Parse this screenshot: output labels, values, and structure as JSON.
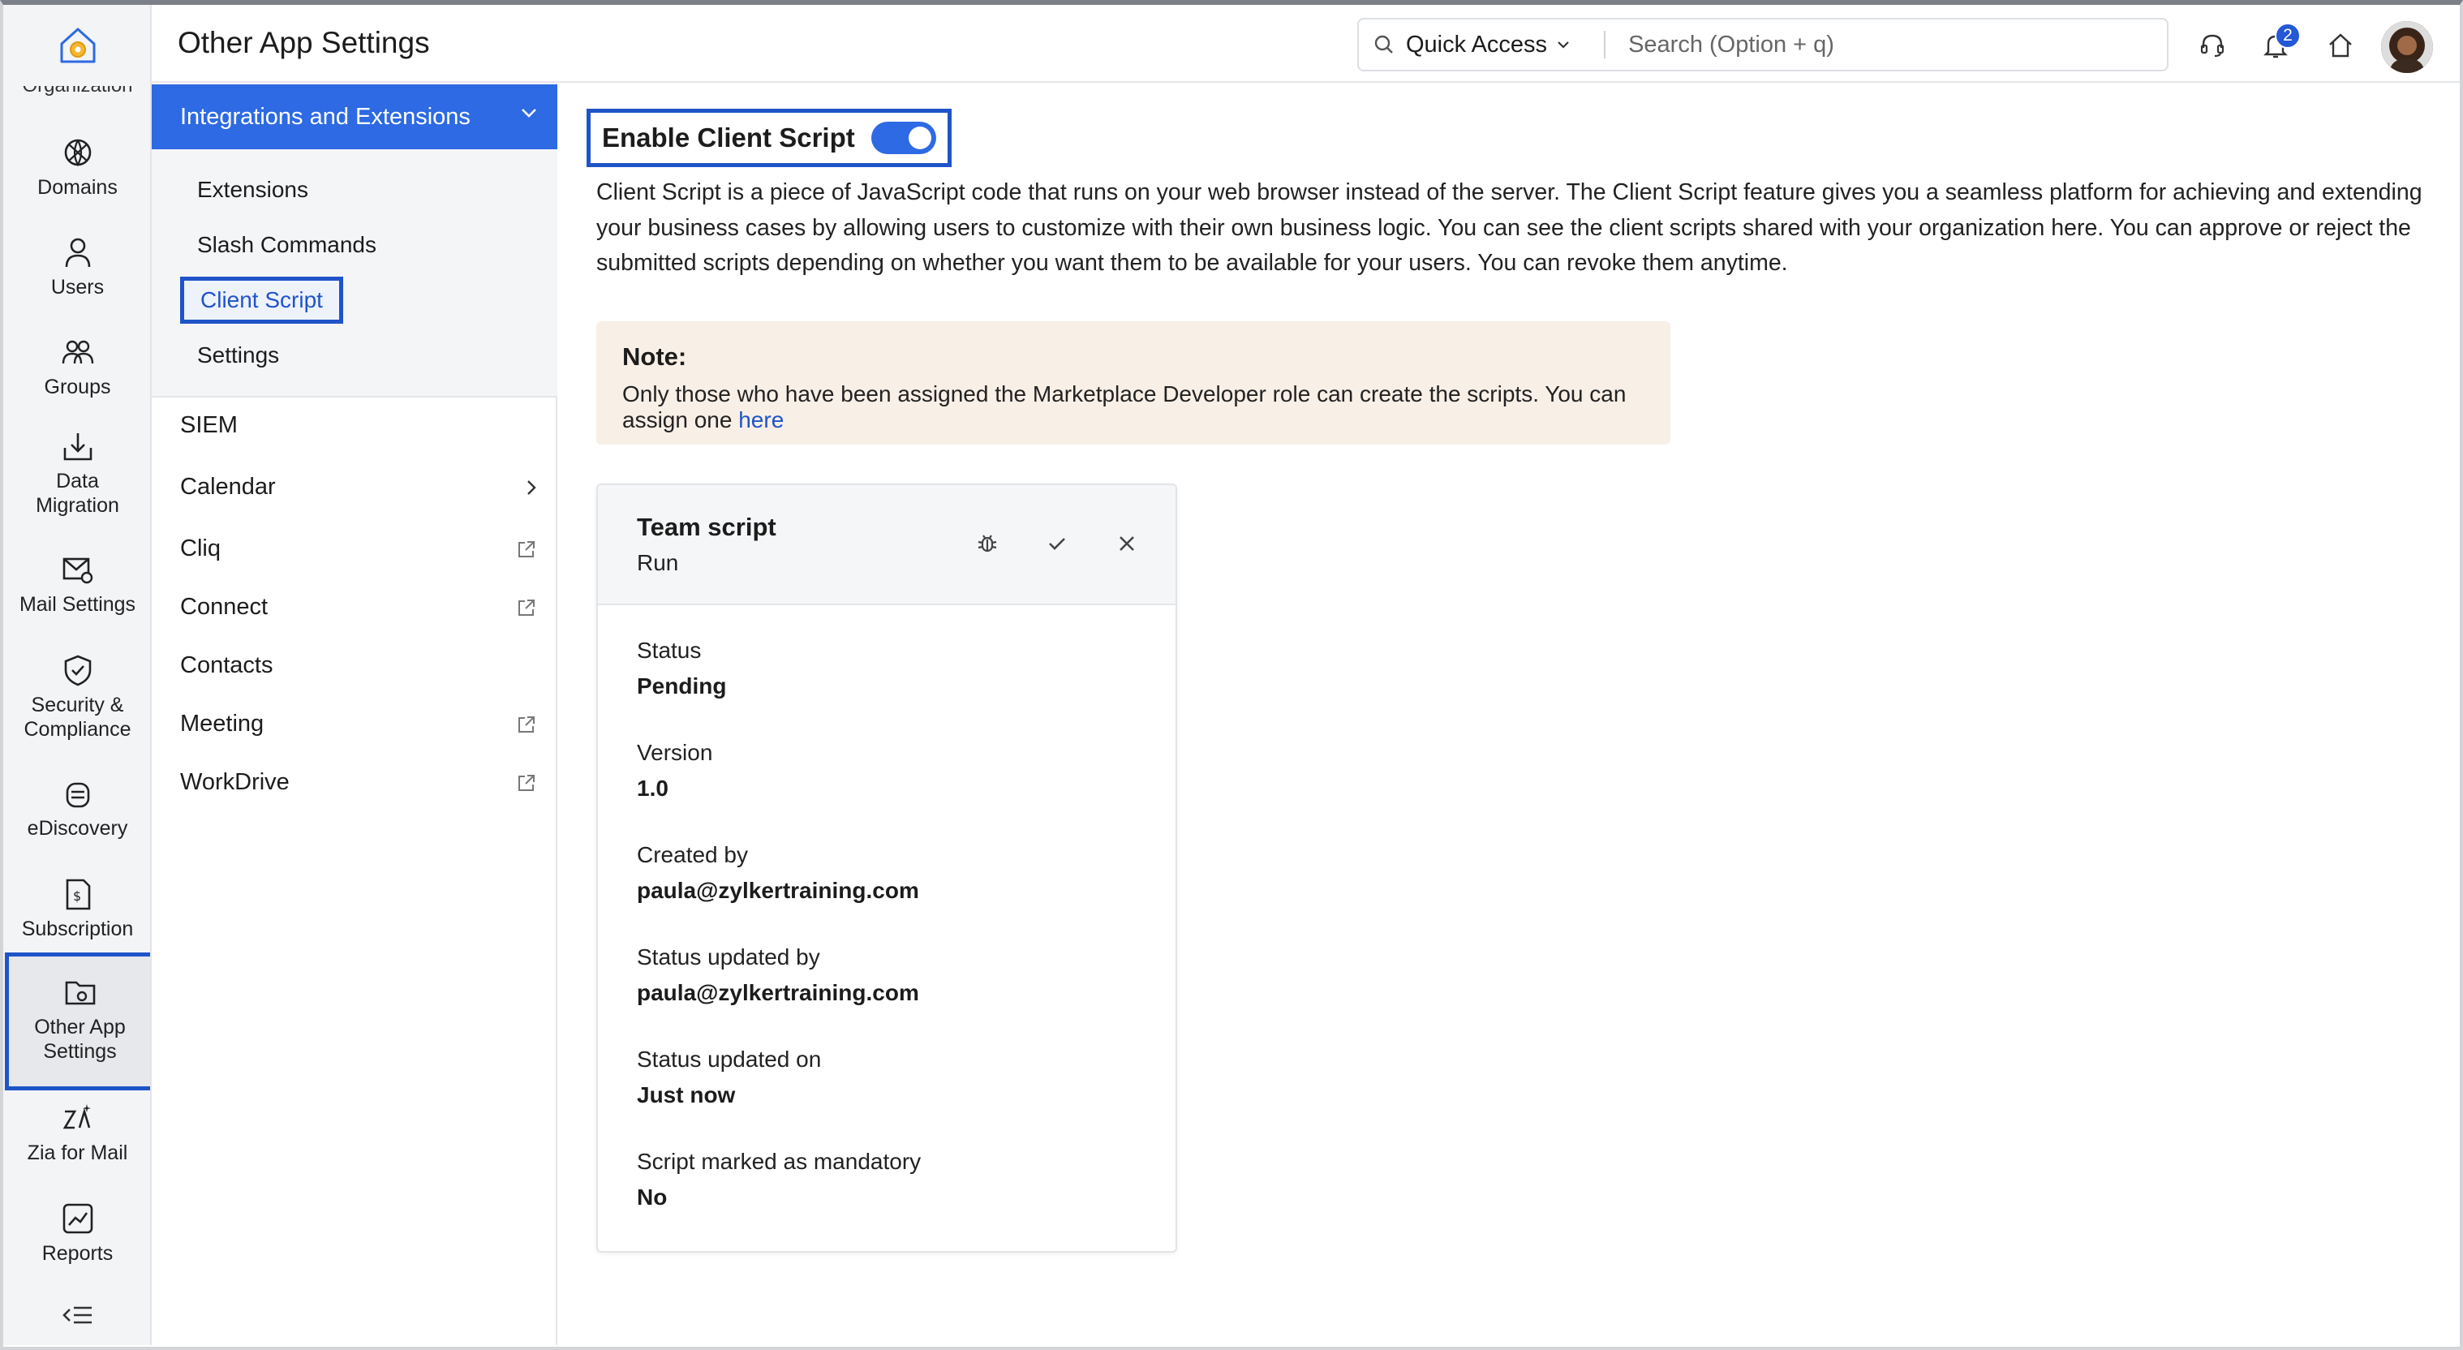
{
  "header": {
    "title": "Other App Settings",
    "quick_access": "Quick Access",
    "search_placeholder": "Search (Option + q)",
    "notification_count": "2"
  },
  "rail": {
    "cut_label": "Organization",
    "items": [
      {
        "label": "Domains",
        "icon": "globe-icon"
      },
      {
        "label": "Users",
        "icon": "user-icon"
      },
      {
        "label": "Groups",
        "icon": "groups-icon"
      },
      {
        "label": "Data Migration",
        "icon": "data-migration-icon"
      },
      {
        "label": "Mail Settings",
        "icon": "mail-settings-icon"
      },
      {
        "label": "Security & Compliance",
        "icon": "shield-icon"
      },
      {
        "label": "eDiscovery",
        "icon": "ediscovery-icon"
      },
      {
        "label": "Subscription",
        "icon": "subscription-icon"
      },
      {
        "label": "Other App Settings",
        "icon": "app-settings-icon"
      },
      {
        "label": "Zia for Mail",
        "icon": "zia-icon"
      },
      {
        "label": "Reports",
        "icon": "reports-icon"
      }
    ],
    "active": "Other App Settings"
  },
  "subnav": {
    "section": "Integrations and Extensions",
    "group_items": [
      "Extensions",
      "Slash Commands",
      "Client Script",
      "Settings"
    ],
    "active": "Client Script",
    "items": [
      {
        "label": "SIEM",
        "trail": "none"
      },
      {
        "label": "Calendar",
        "trail": "chevron"
      },
      {
        "label": "Cliq",
        "trail": "external"
      },
      {
        "label": "Connect",
        "trail": "external"
      },
      {
        "label": "Contacts",
        "trail": "none"
      },
      {
        "label": "Meeting",
        "trail": "external"
      },
      {
        "label": "WorkDrive",
        "trail": "external"
      }
    ]
  },
  "main": {
    "enable_label": "Enable Client Script",
    "enabled": true,
    "description": "Client Script is a piece of JavaScript code that runs on your web browser instead of the server. The Client Script feature gives you a seamless platform for achieving and extending your business cases by allowing users to customize with their own business logic. You can see the client scripts shared with your organization here. You can approve or reject the submitted scripts depending on whether you want them to be available for your users. You can revoke them anytime.",
    "note": {
      "title": "Note:",
      "text": "Only those who have been assigned the Marketplace Developer role can create the scripts. You can assign one ",
      "link": "here"
    },
    "card": {
      "title": "Team script",
      "subtitle": "Run",
      "fields": [
        {
          "label": "Status",
          "value": "Pending"
        },
        {
          "label": "Version",
          "value": "1.0"
        },
        {
          "label": "Created by",
          "value": "paula@zylkertraining.com"
        },
        {
          "label": "Status updated by",
          "value": "paula@zylkertraining.com"
        },
        {
          "label": "Status updated on",
          "value": "Just now"
        },
        {
          "label": "Script marked as mandatory",
          "value": "No"
        }
      ]
    }
  },
  "colors": {
    "accent": "#2d6ae3",
    "highlight_border": "#1f54c9",
    "note_bg": "#f8efe6"
  }
}
